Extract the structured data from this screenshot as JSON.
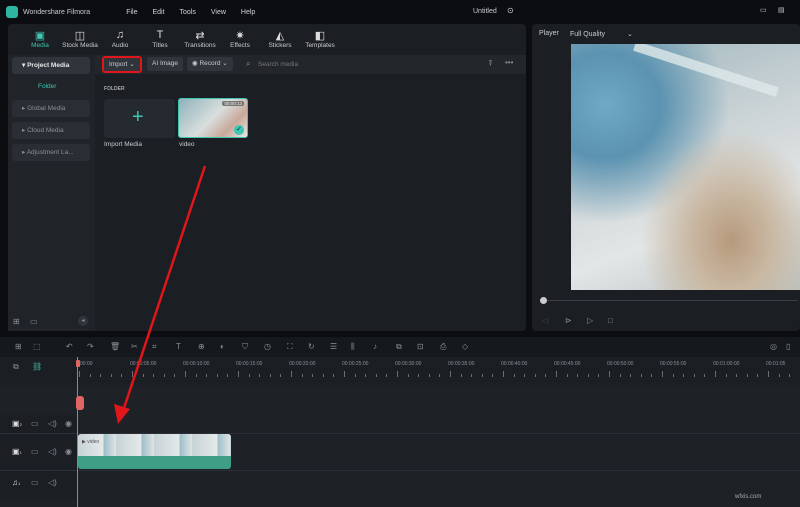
{
  "app": {
    "title": "Wondershare Filmora",
    "project": "Untitled",
    "menu": [
      "File",
      "Edit",
      "Tools",
      "View",
      "Help"
    ]
  },
  "tabs": [
    {
      "label": "Media",
      "icon": "media-icon",
      "glyph": "▣",
      "active": true
    },
    {
      "label": "Stock Media",
      "icon": "stock-media-icon",
      "glyph": "◫"
    },
    {
      "label": "Audio",
      "icon": "music-note-icon",
      "glyph": "♫"
    },
    {
      "label": "Titles",
      "icon": "text-icon",
      "glyph": "T"
    },
    {
      "label": "Transitions",
      "icon": "transitions-icon",
      "glyph": "⇄"
    },
    {
      "label": "Effects",
      "icon": "effects-icon",
      "glyph": "✷"
    },
    {
      "label": "Stickers",
      "icon": "stickers-icon",
      "glyph": "◭"
    },
    {
      "label": "Templates",
      "icon": "templates-icon",
      "glyph": "◧"
    }
  ],
  "sidebar": {
    "items": [
      "Project Media",
      "Folder",
      "Global Media",
      "Cloud Media",
      "Adjustment La..."
    ]
  },
  "toolbar": {
    "import": "Import",
    "ai_image": "AI Image",
    "record": "Record",
    "search_placeholder": "Search media"
  },
  "media": {
    "folder_label": "FOLDER",
    "import_label": "Import Media",
    "video_label": "video",
    "video_duration": "00:00:13"
  },
  "player": {
    "label": "Player",
    "quality": "Full Quality"
  },
  "timeline": {
    "ruler": [
      "00:00",
      "00:00:05:00",
      "00:00:10:00",
      "00:00:15:00",
      "00:00:20:00",
      "00:00:25:00",
      "00:00:30:00",
      "00:00:35:00",
      "00:00:40:00",
      "00:00:45:00",
      "00:00:50:00",
      "00:00:55:00",
      "00:01:00:00",
      "00:01:05"
    ],
    "clip_label": "video",
    "tracks": [
      "2",
      "1",
      "1"
    ]
  },
  "colors": {
    "accent": "#3ec6b0",
    "clip": "#3f9e86",
    "highlight": "#e0161b",
    "playhead": "#e06666"
  }
}
